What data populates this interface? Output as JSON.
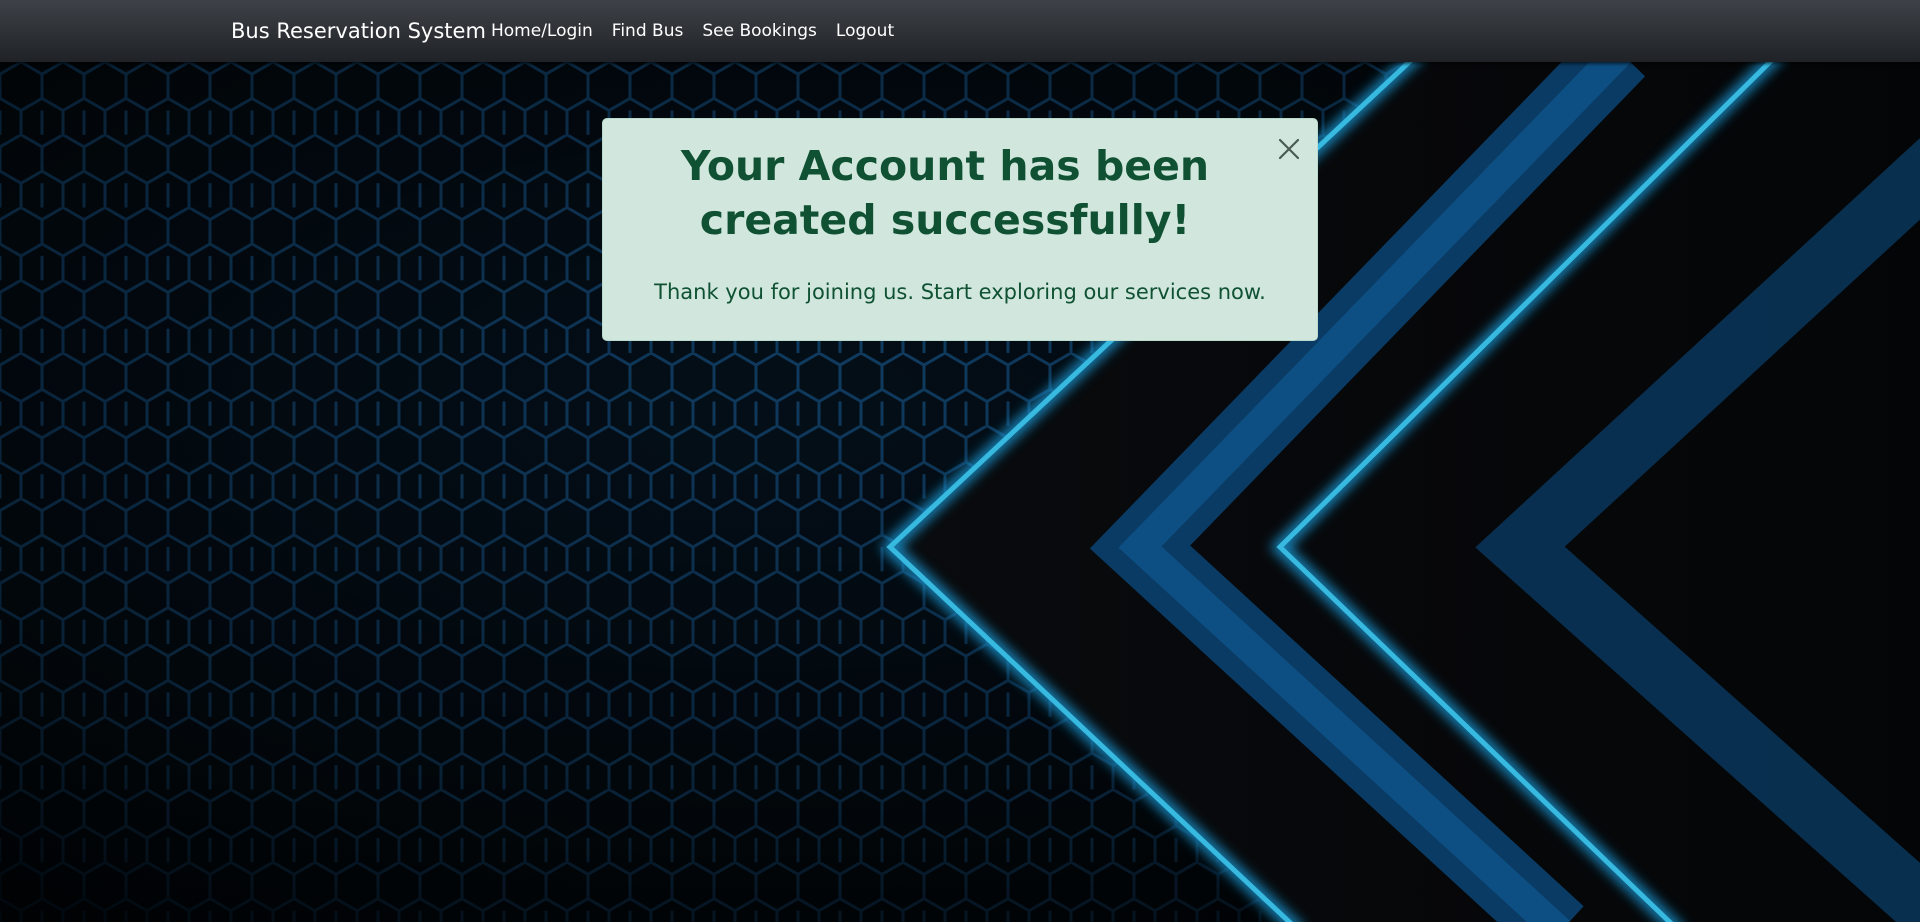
{
  "navbar": {
    "brand": "Bus Reservation System",
    "links": [
      {
        "label": "Home/Login"
      },
      {
        "label": "Find Bus"
      },
      {
        "label": "See Bookings"
      },
      {
        "label": "Logout"
      }
    ]
  },
  "alert": {
    "title": "Your Account has been created successfully!",
    "message": "Thank you for joining us. Start exploring our services now.",
    "close_icon": "close-icon",
    "background_color": "#d1e7dd",
    "text_color": "#0f5132"
  },
  "theme": {
    "navbar_color": "#2b2f33",
    "accent_color": "#1ec8ff"
  }
}
